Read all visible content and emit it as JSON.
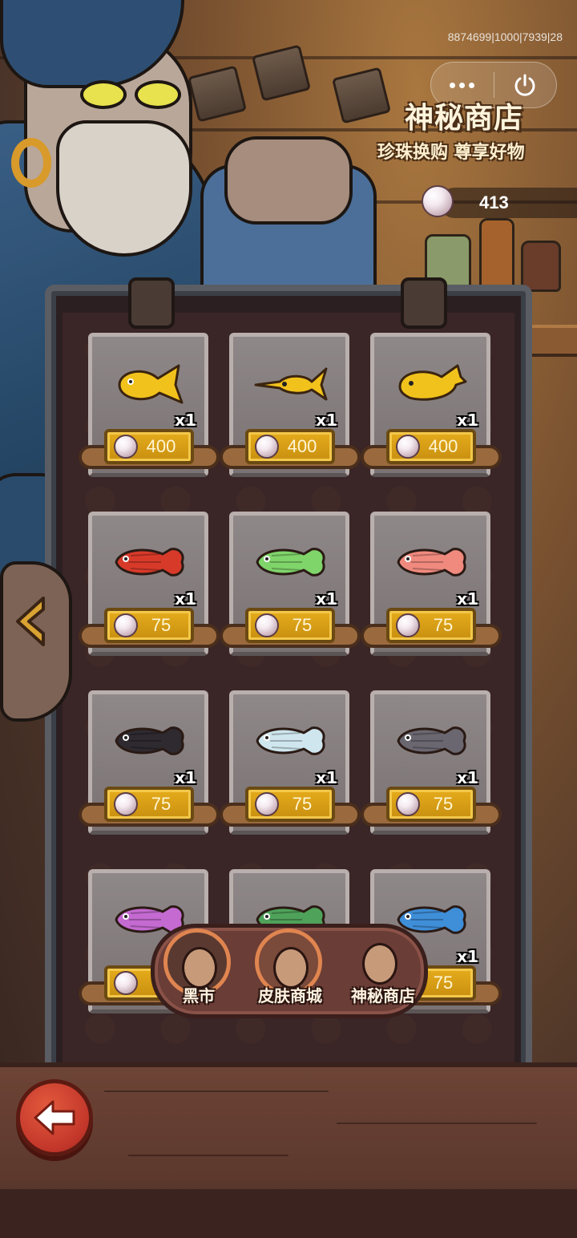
{
  "debug_id": "8874699|1000|7939|28",
  "capsule": {
    "more_icon": "more-dots-icon",
    "close_icon": "power-icon"
  },
  "header": {
    "title": "神秘商店",
    "subtitle": "珍珠换购 尊享好物"
  },
  "balance": {
    "currency_icon": "pearl-icon",
    "value": "413"
  },
  "items": [
    {
      "fish": "golden-goldfish",
      "color": "#f2c21c",
      "qty": "x1",
      "price": "400"
    },
    {
      "fish": "golden-swordfish",
      "color": "#f2c21c",
      "qty": "x1",
      "price": "400"
    },
    {
      "fish": "golden-whale",
      "color": "#f2c21c",
      "qty": "x1",
      "price": "400"
    },
    {
      "fish": "red-arowana",
      "color": "#d83a2a",
      "qty": "x1",
      "price": "75"
    },
    {
      "fish": "green-arowana",
      "color": "#7fd46a",
      "qty": "x1",
      "price": "75"
    },
    {
      "fish": "pink-arowana",
      "color": "#f08a7e",
      "qty": "x1",
      "price": "75"
    },
    {
      "fish": "black-arowana",
      "color": "#2e2a30",
      "qty": "x1",
      "price": "75"
    },
    {
      "fish": "silver-arowana",
      "color": "#cfe6ee",
      "qty": "x1",
      "price": "75"
    },
    {
      "fish": "black-white-arowana",
      "color": "#6b6770",
      "qty": "x1",
      "price": "75"
    },
    {
      "fish": "purple-arowana",
      "color": "#c46ad1",
      "qty": "",
      "price": ""
    },
    {
      "fish": "green-red-arowana",
      "color": "#4fa25a",
      "qty": "",
      "price": ""
    },
    {
      "fish": "blue-arowana",
      "color": "#3f8ed8",
      "qty": "x1",
      "price": "75"
    }
  ],
  "tabs": [
    {
      "label": "黑市",
      "icon": "pirate-avatar-icon",
      "selected": false
    },
    {
      "label": "皮肤商城",
      "icon": "sunglasses-avatar-icon",
      "selected": false
    },
    {
      "label": "神秘商店",
      "icon": "old-man-avatar-icon",
      "selected": true
    }
  ],
  "back_button": {
    "icon": "arrow-left-icon"
  },
  "colors": {
    "gold": "#e6ac1c",
    "tab_bar": "#6a3d36",
    "back_button": "#c2362a"
  }
}
